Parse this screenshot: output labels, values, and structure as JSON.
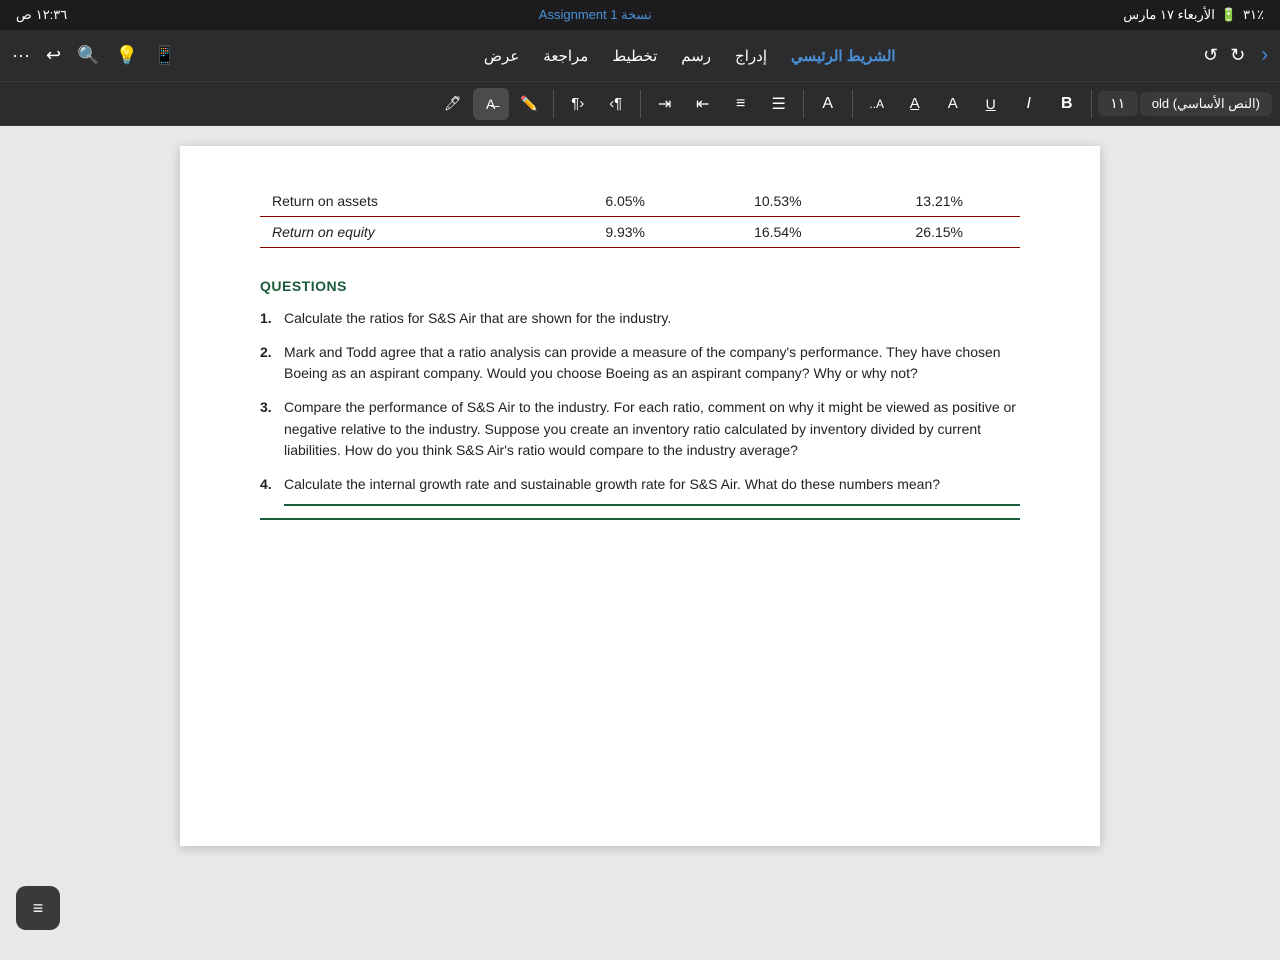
{
  "statusBar": {
    "time": "١٢:٣٦",
    "dayDate": "الأربعاء ١٧ مارس",
    "period": "ص",
    "battery": "٪٣١",
    "batteryIcon": "🔋"
  },
  "titleBar": {
    "docTitle": "نسخة Assignment 1",
    "menuItems": [
      {
        "label": "الشريط الرئيسي",
        "active": true
      },
      {
        "label": "إدراج",
        "active": false
      },
      {
        "label": "رسم",
        "active": false
      },
      {
        "label": "تخطيط",
        "active": false
      },
      {
        "label": "مراجعة",
        "active": false
      },
      {
        "label": "عرض",
        "active": false
      }
    ]
  },
  "toolbar": {
    "fontName": "(النص الأساسي) old",
    "fontSize": "١١",
    "boldLabel": "B",
    "italicLabel": "I",
    "underlineLabel": "U"
  },
  "table": {
    "row1": {
      "label": "Return on assets",
      "col1": "6.05%",
      "col2": "10.53%",
      "col3": "13.21%"
    },
    "row2": {
      "label": "Return on equity",
      "col1": "9.93%",
      "col2": "16.54%",
      "col3": "26.15%"
    }
  },
  "questions": {
    "title": "QUESTIONS",
    "items": [
      {
        "number": "1.",
        "text": "Calculate the ratios for S&S Air that are shown for the industry."
      },
      {
        "number": "2.",
        "text": "Mark and Todd agree that a ratio analysis can provide a measure of the company's performance. They have chosen Boeing as an aspirant company. Would you choose Boeing as an aspirant company? Why or why not?"
      },
      {
        "number": "3.",
        "text": "Compare the performance of S&S Air to the industry. For each ratio, comment on why it might be viewed as positive or negative relative to the industry. Suppose you create an inventory ratio calculated by inventory divided by current liabilities. How do you think S&S Air's ratio would compare to the industry average?"
      },
      {
        "number": "4.",
        "text": "Calculate the internal growth rate and sustainable growth rate for S&S Air. What do these numbers mean?"
      }
    ]
  },
  "floatingMenu": {
    "icon": "≡"
  }
}
